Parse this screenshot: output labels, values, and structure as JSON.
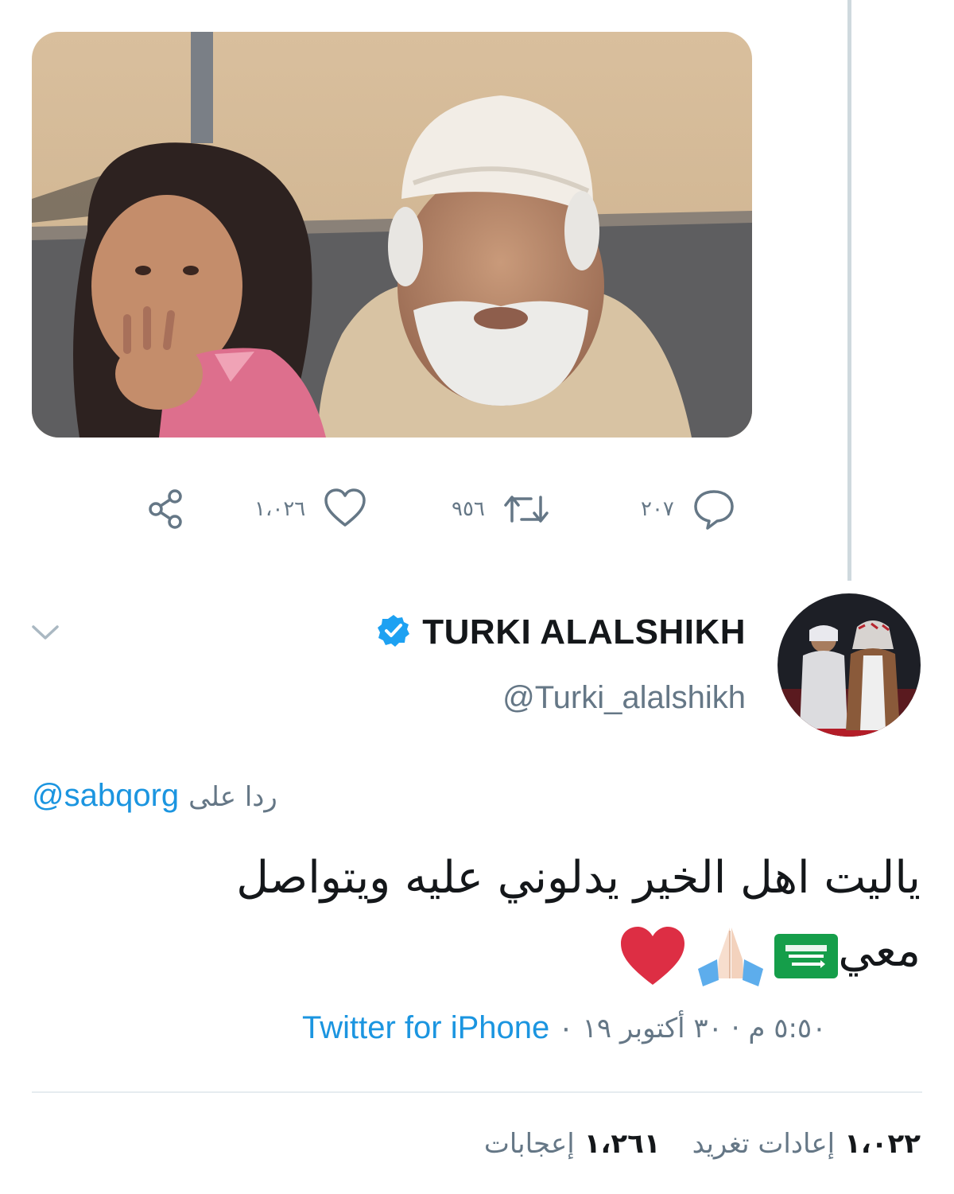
{
  "top_tweet": {
    "actions": {
      "reply_count": "٢٠٧",
      "retweet_count": "٩٥٦",
      "like_count": "١،٠٢٦"
    }
  },
  "tweet": {
    "display_name": "TURKI ALALSHIKH",
    "handle": "@Turki_alalshikh",
    "reply_prefix": "ردا على",
    "reply_mention": "@sabqorg",
    "text_line1": "ياليت اهل الخير يدلوني عليه ويتواصل",
    "text_line2": "معي",
    "date": "٥:٥٠ م · ٣٠ أكتوبر ١٩",
    "separator": "·",
    "source": "Twitter for iPhone",
    "retweets_count": "١،٠٢٢",
    "retweets_label": "إعادات تغريد",
    "likes_count": "١،٢٦١",
    "likes_label": "إعجابات"
  },
  "icons": {
    "reply": "speech-bubble-icon",
    "retweet": "retweet-arrows-icon",
    "like": "heart-outline-icon",
    "share": "share-nodes-icon",
    "verified": "verified-badge-icon",
    "chevron": "chevron-down-icon",
    "emojis": [
      "saudi-flag-emoji",
      "folded-hands-emoji",
      "red-heart-emoji"
    ]
  },
  "colors": {
    "link": "#1b95e0",
    "secondary_text": "#657786",
    "verified": "#1da1f2",
    "divider": "#e6ecf0",
    "thread_line": "#cfd9de"
  }
}
